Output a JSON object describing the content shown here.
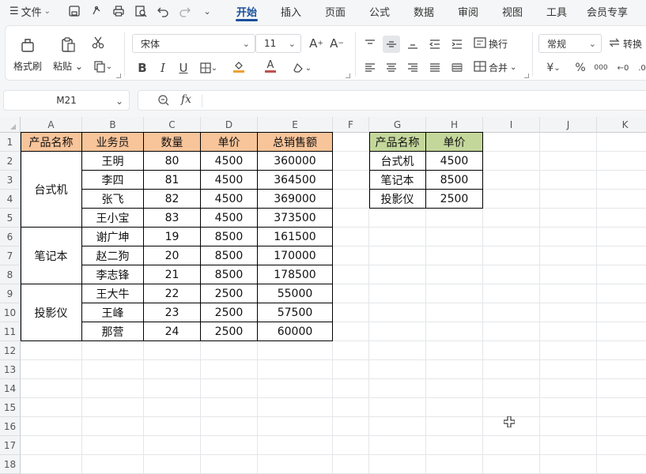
{
  "menubar": {
    "hamburger_icon": "menu-icon",
    "file_label": "文件",
    "tabs": [
      "开始",
      "插入",
      "页面",
      "公式",
      "数据",
      "审阅",
      "视图",
      "工具",
      "会员专享"
    ],
    "active_tab": "开始"
  },
  "ribbon": {
    "format_painter": "格式刷",
    "paste": "粘贴",
    "font_name": "宋体",
    "font_size": "11",
    "wrap": "换行",
    "merge": "合并",
    "number_format": "常规",
    "convert": "转换",
    "percent": "%",
    "thousands": "000",
    "accent_color": "#1a4f9c",
    "font_color_bar": "#c0504d",
    "fill_color_bar": "#f0a030"
  },
  "formula_bar": {
    "name_box": "M21",
    "fx_label": "fx",
    "content": ""
  },
  "grid": {
    "columns": [
      "A",
      "B",
      "C",
      "D",
      "E",
      "F",
      "G",
      "H",
      "I",
      "J",
      "K"
    ],
    "rows": [
      "1",
      "2",
      "3",
      "4",
      "5",
      "6",
      "7",
      "8",
      "9",
      "10",
      "11",
      "12",
      "13",
      "14",
      "15",
      "16",
      "17",
      "18"
    ],
    "table1": {
      "header_color": "#f8c49a",
      "headers": [
        "产品名称",
        "业务员",
        "数量",
        "单价",
        "总销售额"
      ],
      "groups": [
        {
          "product": "台式机",
          "rows": [
            [
              "王明",
              "80",
              "4500",
              "360000"
            ],
            [
              "李四",
              "81",
              "4500",
              "364500"
            ],
            [
              "张飞",
              "82",
              "4500",
              "369000"
            ],
            [
              "王小宝",
              "83",
              "4500",
              "373500"
            ]
          ]
        },
        {
          "product": "笔记本",
          "rows": [
            [
              "谢广坤",
              "19",
              "8500",
              "161500"
            ],
            [
              "赵二狗",
              "20",
              "8500",
              "170000"
            ],
            [
              "李志锋",
              "21",
              "8500",
              "178500"
            ]
          ]
        },
        {
          "product": "投影仪",
          "rows": [
            [
              "王大牛",
              "22",
              "2500",
              "55000"
            ],
            [
              "王峰",
              "23",
              "2500",
              "57500"
            ],
            [
              "那营",
              "24",
              "2500",
              "60000"
            ]
          ]
        }
      ]
    },
    "table2": {
      "header_color": "#c4d79b",
      "headers": [
        "产品名称",
        "单价"
      ],
      "rows": [
        [
          "台式机",
          "4500"
        ],
        [
          "笔记本",
          "8500"
        ],
        [
          "投影仪",
          "2500"
        ]
      ]
    }
  }
}
